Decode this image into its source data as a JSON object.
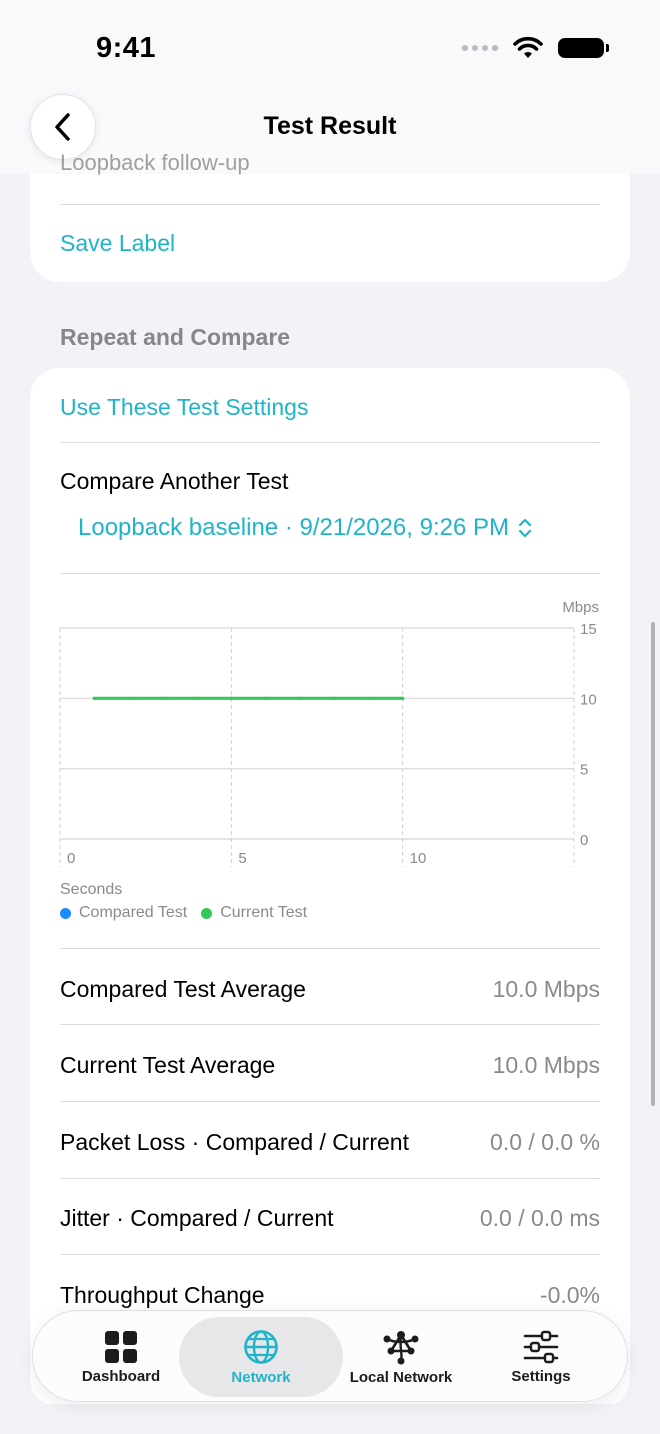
{
  "status": {
    "time": "9:41"
  },
  "nav": {
    "title": "Test Result"
  },
  "label_card": {
    "faded_value": "Loopback follow-up",
    "save_label": "Save Label"
  },
  "repeat_section": {
    "header": "Repeat and Compare",
    "use_settings": "Use These Test Settings",
    "compare_label": "Compare Another Test",
    "compare_selected": "Loopback baseline · 9/21/2026, 9:26 PM"
  },
  "chart_data": {
    "type": "line",
    "xlabel": "Seconds",
    "ylabel": "Mbps",
    "xlim": [
      0,
      15
    ],
    "ylim": [
      0,
      15
    ],
    "x_ticks": [
      "0",
      "5",
      "10"
    ],
    "y_ticks": [
      "15",
      "10",
      "5",
      "0"
    ],
    "grid": true,
    "series": [
      {
        "name": "Compared Test",
        "color": "#1a8cff",
        "x": [],
        "y": []
      },
      {
        "name": "Current Test",
        "color": "#34c759",
        "x": [
          1,
          2,
          3,
          4,
          5,
          6,
          7,
          8,
          9,
          10
        ],
        "y": [
          10,
          10,
          10,
          10,
          10,
          10,
          10,
          10,
          10,
          10
        ]
      }
    ],
    "legend": "bottom-left"
  },
  "stats": [
    {
      "label": "Compared Test Average",
      "value": "10.0 Mbps"
    },
    {
      "label": "Current Test Average",
      "value": "10.0 Mbps"
    },
    {
      "label": "Packet Loss · Compared / Current",
      "value": "0.0 / 0.0 %"
    },
    {
      "label": "Jitter · Compared / Current",
      "value": "0.0 / 0.0 ms"
    },
    {
      "label": "Throughput Change",
      "value": "-0.0%"
    }
  ],
  "tabs": [
    {
      "label": "Dashboard",
      "icon": "grid-icon"
    },
    {
      "label": "Network",
      "icon": "globe-icon",
      "active": true
    },
    {
      "label": "Local Network",
      "icon": "local-network-icon"
    },
    {
      "label": "Settings",
      "icon": "sliders-icon"
    }
  ],
  "colors": {
    "accent": "#1fb4c9",
    "current_series": "#34c759",
    "compared_series": "#1a8cff"
  }
}
